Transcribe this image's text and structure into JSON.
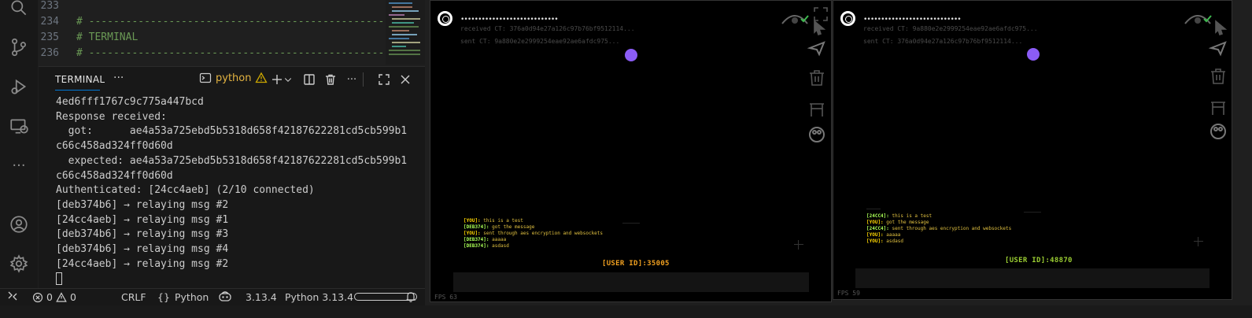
{
  "editor": {
    "lines": [
      {
        "num": "233",
        "text": ""
      },
      {
        "num": "234",
        "text": "# ----------------------------------------------------"
      },
      {
        "num": "235",
        "text": "# TERMINAL"
      },
      {
        "num": "236",
        "text": "# ----------------------------------------------------"
      }
    ]
  },
  "panel": {
    "tab_label": "TERMINAL",
    "more_label": "···",
    "terminal_name": "python",
    "output": [
      "4ed6fff1767c9c775a447bcd",
      "Response received:",
      "  got:      ae4a53a725ebd5b5318d658f42187622281cd5cb599b1",
      "c66c458ad324ff0d60d",
      "  expected: ae4a53a725ebd5b5318d658f42187622281cd5cb599b1",
      "c66c458ad324ff0d60d",
      "Authenticated: [24cc4aeb] (2/10 connected)",
      "[deb374b6] → relaying msg #2",
      "[24cc4aeb] → relaying msg #1",
      "[deb374b6] → relaying msg #3",
      "[deb374b6] → relaying msg #4",
      "[24cc4aeb] → relaying msg #2"
    ]
  },
  "status": {
    "errors": "0",
    "warnings": "0",
    "eol": "CRLF",
    "lang_braces": "{}",
    "language": "Python",
    "version": "3.13.4",
    "interpreter": "Python 3.13.4"
  },
  "games": [
    {
      "title": "••••••••••••••••••••••••••••",
      "received": "received CT: 376a0d94e27a126c97b76bf9512114...",
      "sent": "sent CT: 9a880e2e2999254eae92ae6afdc975...",
      "chat": [
        {
          "name": "[YOU]:",
          "msg": " this is a test",
          "own": true
        },
        {
          "name": "[DEB374]:",
          "msg": " got the message",
          "own": false
        },
        {
          "name": "[YOU]:",
          "msg": " sent through aes encryption and websockets",
          "own": true
        },
        {
          "name": "[DEB374]:",
          "msg": " aaaaa",
          "own": false
        },
        {
          "name": "[DEB374]:",
          "msg": " asdasd",
          "own": false
        }
      ],
      "user_id": "[USER ID]:35005",
      "user_id_color": "#f0a020",
      "fps": "FPS 63"
    },
    {
      "title": "••••••••••••••••••••••••••••",
      "received": "received CT: 9a880e2e2999254eae92ae6afdc975...",
      "sent": "sent CT: 376a0d94e27a126c97b76bf9512114...",
      "chat": [
        {
          "name": "[24CC4]:",
          "msg": " this is a test",
          "own": false
        },
        {
          "name": "[YOU]:",
          "msg": " got the message",
          "own": true
        },
        {
          "name": "[24CC4]:",
          "msg": " sent through aes encryption and websockets",
          "own": false
        },
        {
          "name": "[YOU]:",
          "msg": " aaaaa",
          "own": true
        },
        {
          "name": "[YOU]:",
          "msg": " asdasd",
          "own": true
        }
      ],
      "user_id": "[USER ID]:48870",
      "user_id_color": "#9acd32",
      "fps": "FPS 59"
    }
  ],
  "colors": {
    "accent": "#0078d4",
    "warning": "#cca700",
    "comment": "#6a9955",
    "player_dot": "#8b5cf6"
  }
}
